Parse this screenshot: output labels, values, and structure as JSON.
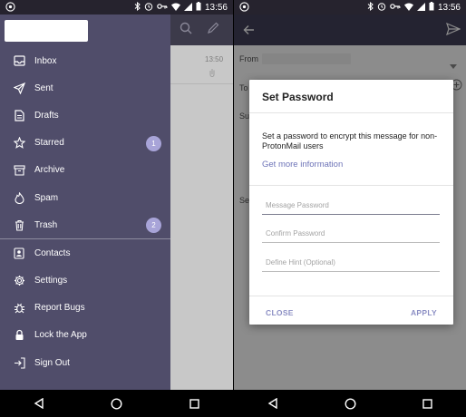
{
  "status_bar": {
    "time": "13:56",
    "left_icon": "app-notification-icon",
    "right_icons": [
      "bluetooth-icon",
      "alarm-icon",
      "vpn-key-icon",
      "wifi-icon",
      "signal-icon",
      "battery-icon"
    ]
  },
  "left": {
    "drawer": {
      "menu_top": [
        {
          "name": "inbox",
          "label": "Inbox",
          "icon": "inbox-icon"
        },
        {
          "name": "sent",
          "label": "Sent",
          "icon": "send-icon"
        },
        {
          "name": "drafts",
          "label": "Drafts",
          "icon": "document-icon"
        },
        {
          "name": "starred",
          "label": "Starred",
          "icon": "star-icon",
          "badge": "1"
        },
        {
          "name": "archive",
          "label": "Archive",
          "icon": "archive-icon"
        },
        {
          "name": "spam",
          "label": "Spam",
          "icon": "fire-icon"
        },
        {
          "name": "trash",
          "label": "Trash",
          "icon": "trash-icon",
          "badge": "2"
        }
      ],
      "menu_bottom": [
        {
          "name": "contacts",
          "label": "Contacts",
          "icon": "contacts-icon"
        },
        {
          "name": "settings",
          "label": "Settings",
          "icon": "gear-icon"
        },
        {
          "name": "report-bugs",
          "label": "Report Bugs",
          "icon": "bug-icon"
        },
        {
          "name": "lock-the-app",
          "label": "Lock the App",
          "icon": "lock-icon"
        },
        {
          "name": "sign-out",
          "label": "Sign Out",
          "icon": "sign-out-icon"
        }
      ],
      "badge_color": "#a8a4d8",
      "background_color": "#504d6a"
    },
    "background_list": {
      "row_time": "13:50"
    }
  },
  "right": {
    "compose": {
      "from_label": "From",
      "to_label": "To",
      "subject_label": "Su",
      "body_label": "Se"
    },
    "dialog": {
      "title": "Set Password",
      "message": "Set a password to encrypt this message for non-ProtonMail users",
      "link": "Get more information",
      "message_password_placeholder": "Message Password",
      "confirm_password_placeholder": "Confirm Password",
      "hint_placeholder": "Define Hint (Optional)",
      "close_label": "CLOSE",
      "apply_label": "APPLY",
      "accent_color": "#8c8fc4"
    }
  },
  "nav": {
    "icons": [
      "back-icon",
      "home-icon",
      "recents-icon"
    ]
  }
}
